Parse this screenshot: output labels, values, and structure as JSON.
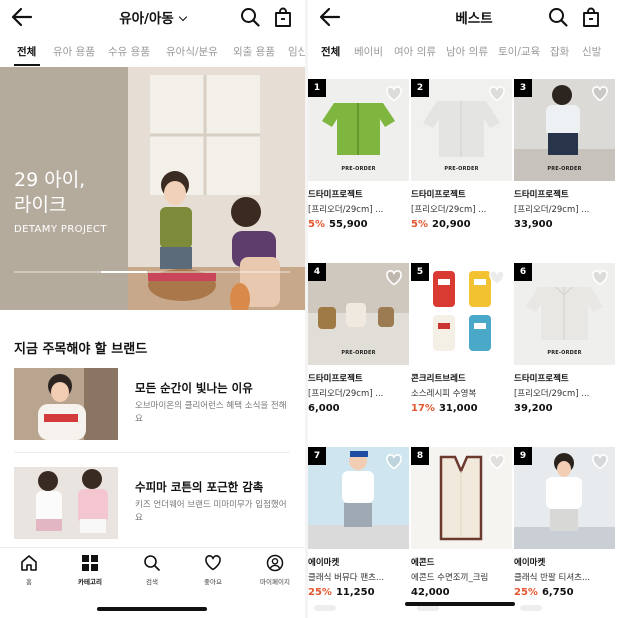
{
  "left": {
    "header": {
      "title": "유아/아동"
    },
    "tabs": [
      {
        "label": "전체",
        "active": true
      },
      {
        "label": "유아 용품",
        "active": false
      },
      {
        "label": "수유 용품",
        "active": false
      },
      {
        "label": "유아식/분유",
        "active": false
      },
      {
        "label": "외출 용품",
        "active": false
      },
      {
        "label": "임신",
        "active": false
      }
    ],
    "hero": {
      "title_line1": "29 아이,",
      "title_line2": "라이크",
      "subtitle": "DETAMY PROJECT",
      "progress": 0.4
    },
    "section_title": "지금 주목해야 할 브랜드",
    "brands": [
      {
        "title": "모든 순간이 빛나는 이유",
        "desc": "오브마이온의 클리어런스 혜택 소식을 전해요"
      },
      {
        "title": "수피마 코튼의 포근한 감촉",
        "desc": "키즈 언더웨어 브랜드 미마미무가 입점했어요"
      }
    ],
    "bottom_nav": [
      {
        "label": "홈",
        "icon": "home-icon",
        "active": false
      },
      {
        "label": "카테고리",
        "icon": "category-grid-icon",
        "active": true
      },
      {
        "label": "검색",
        "icon": "search-icon",
        "active": false
      },
      {
        "label": "좋아요",
        "icon": "heart-icon",
        "active": false
      },
      {
        "label": "마이페이지",
        "icon": "user-icon",
        "active": false
      }
    ]
  },
  "right": {
    "header": {
      "title": "베스트"
    },
    "tabs": [
      {
        "label": "전체",
        "active": true
      },
      {
        "label": "베이비",
        "active": false
      },
      {
        "label": "여아 의류",
        "active": false
      },
      {
        "label": "남아 의류",
        "active": false
      },
      {
        "label": "토이/교육",
        "active": false
      },
      {
        "label": "잡화",
        "active": false
      },
      {
        "label": "신발",
        "active": false
      }
    ],
    "products": [
      {
        "rank": "1",
        "brand": "드타미프로젝트",
        "name": "[프리오더/29cm] ...",
        "discount": "5%",
        "price": "55,900",
        "preorder": "PRE-ORDER"
      },
      {
        "rank": "2",
        "brand": "드타미프로젝트",
        "name": "[프리오더/29cm] ...",
        "discount": "5%",
        "price": "20,900",
        "preorder": "PRE-ORDER"
      },
      {
        "rank": "3",
        "brand": "드타미프로젝트",
        "name": "[프리오더/29cm] ...",
        "discount": "",
        "price": "33,900",
        "preorder": "PRE-ORDER"
      },
      {
        "rank": "4",
        "brand": "드타미프로젝트",
        "name": "[프리오더/29cm] ...",
        "discount": "",
        "price": "6,000",
        "preorder": "PRE-ORDER"
      },
      {
        "rank": "5",
        "brand": "콘크리트브레드",
        "name": "소스레시피 수영복",
        "discount": "17%",
        "price": "31,000",
        "preorder": ""
      },
      {
        "rank": "6",
        "brand": "드타미프로젝트",
        "name": "[프리오더/29cm] ...",
        "discount": "",
        "price": "39,200",
        "preorder": "PRE-ORDER"
      },
      {
        "rank": "7",
        "brand": "에이마켓",
        "name": "클래식 버뮤다 팬츠...",
        "discount": "25%",
        "price": "11,250",
        "preorder": ""
      },
      {
        "rank": "8",
        "brand": "에콘드",
        "name": "에콘드 수면조끼_크림",
        "discount": "",
        "price": "42,000",
        "preorder": ""
      },
      {
        "rank": "9",
        "brand": "에이마켓",
        "name": "클래식 반팔 티셔츠...",
        "discount": "25%",
        "price": "6,750",
        "preorder": ""
      }
    ]
  },
  "colors": {
    "discount": "#e4572e",
    "badge": "#000000"
  }
}
